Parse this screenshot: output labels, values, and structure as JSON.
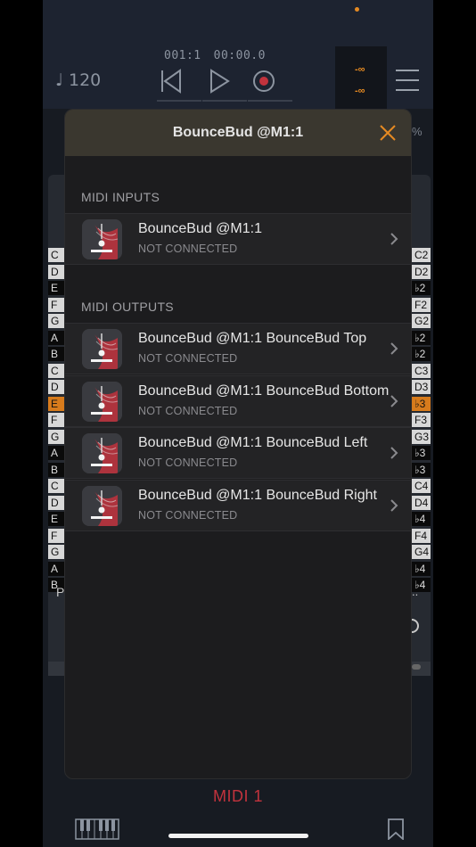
{
  "transport": {
    "tempo": "♩ 120",
    "position": "001:1",
    "time": "00:00.0",
    "meter_top": "-∞",
    "meter_bottom": "-∞"
  },
  "modal": {
    "title": "BounceBud @M1:1",
    "inputs_label": "MIDI INPUTS",
    "outputs_label": "MIDI OUTPUTS",
    "inputs": [
      {
        "name": "BounceBud @M1:1",
        "status": "NOT CONNECTED"
      }
    ],
    "outputs": [
      {
        "name": "BounceBud @M1:1 BounceBud Top",
        "status": "NOT CONNECTED"
      },
      {
        "name": "BounceBud @M1:1 BounceBud Bottom",
        "status": "NOT CONNECTED"
      },
      {
        "name": "BounceBud @M1:1 BounceBud Left",
        "status": "NOT CONNECTED"
      },
      {
        "name": "BounceBud @M1:1 BounceBud Right",
        "status": "NOT CONNECTED"
      }
    ]
  },
  "footer": {
    "track_label": "MIDI 1"
  },
  "background_keys": {
    "left": [
      "C",
      "D",
      "E",
      "F",
      "G",
      "A",
      "B",
      "C",
      "D",
      "E",
      "F",
      "G",
      "A",
      "B",
      "C",
      "D",
      "E",
      "F",
      "G",
      "A",
      "B"
    ],
    "right": [
      "C2",
      "D2",
      "♭2",
      "F2",
      "G2",
      "♭2",
      "♭2",
      "C3",
      "D3",
      "♭3",
      "F3",
      "G3",
      "♭3",
      "♭3",
      "C4",
      "D4",
      "♭4",
      "F4",
      "G4",
      "♭4",
      "♭4"
    ],
    "frag_p": "P",
    "frag_dots": "..",
    "frag_pct": "%"
  },
  "colors": {
    "accent_orange": "#e58a22",
    "track_red": "#c2333d",
    "modal_header": "#3a372f"
  }
}
